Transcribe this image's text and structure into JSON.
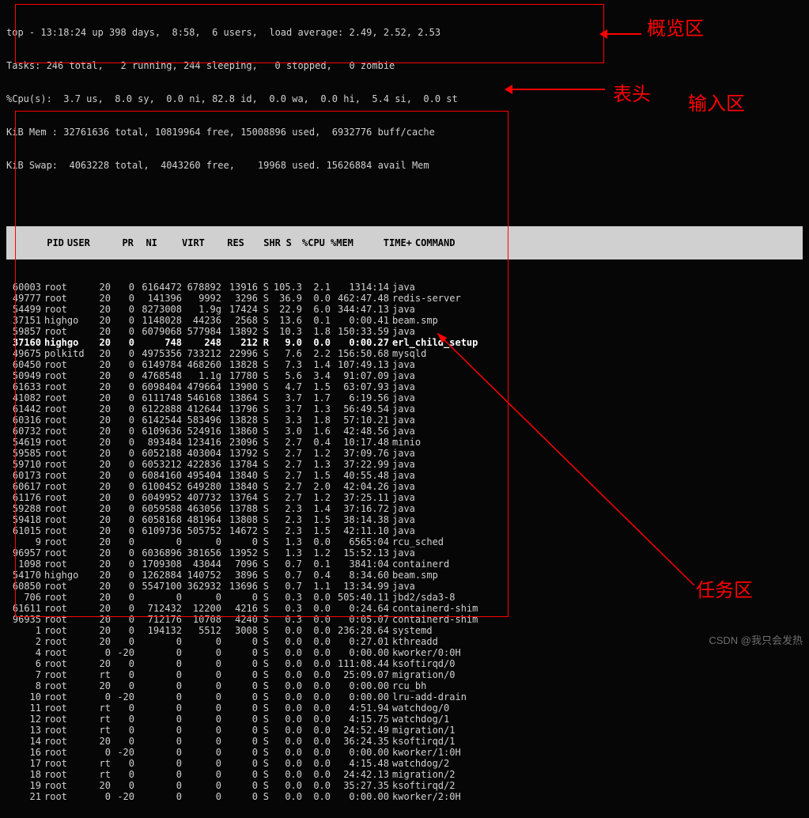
{
  "summary": {
    "line1_pre": "top - ",
    "time": "13:18:24",
    "line1_mid": " up 398 days,  8:58,  6 users,  load average: 2.49, 2.52, 2.53",
    "tasks": "Tasks: 246 total,   2 running, 244 sleeping,   0 stopped,   0 zombie",
    "cpu": "%Cpu(s):  3.7 us,  8.0 sy,  0.0 ni, 82.8 id,  0.0 wa,  0.0 hi,  5.4 si,  0.0 st",
    "mem": "KiB Mem : 32761636 total, 10819964 free, 15008896 used,  6932776 buff/cache",
    "swap": "KiB Swap:  4063228 total,  4043260 free,    19968 used. 15626884 avail Mem"
  },
  "header": {
    "pid": "PID",
    "user": "USER",
    "pr": "PR",
    "ni": "NI",
    "virt": "VIRT",
    "res": "RES",
    "shr": "SHR",
    "s": "S",
    "cpu": "%CPU",
    "mem": "%MEM",
    "time": "TIME+",
    "cmd": "COMMAND"
  },
  "processes": [
    {
      "pid": "60003",
      "user": "root",
      "pr": "20",
      "ni": "0",
      "virt": "6164472",
      "res": "678892",
      "shr": "13916",
      "s": "S",
      "cpu": "105.3",
      "mem": "2.1",
      "time": "1314:14",
      "cmd": "java",
      "bold": false
    },
    {
      "pid": "49777",
      "user": "root",
      "pr": "20",
      "ni": "0",
      "virt": "141396",
      "res": "9992",
      "shr": "3296",
      "s": "S",
      "cpu": "36.9",
      "mem": "0.0",
      "time": "462:47.48",
      "cmd": "redis-server",
      "bold": false
    },
    {
      "pid": "54499",
      "user": "root",
      "pr": "20",
      "ni": "0",
      "virt": "8273008",
      "res": "1.9g",
      "shr": "17424",
      "s": "S",
      "cpu": "22.9",
      "mem": "6.0",
      "time": "344:47.13",
      "cmd": "java",
      "bold": false
    },
    {
      "pid": "37151",
      "user": "highgo",
      "pr": "20",
      "ni": "0",
      "virt": "1148028",
      "res": "44236",
      "shr": "2568",
      "s": "S",
      "cpu": "13.6",
      "mem": "0.1",
      "time": "0:00.41",
      "cmd": "beam.smp",
      "bold": false
    },
    {
      "pid": "59857",
      "user": "root",
      "pr": "20",
      "ni": "0",
      "virt": "6079068",
      "res": "577984",
      "shr": "13892",
      "s": "S",
      "cpu": "10.3",
      "mem": "1.8",
      "time": "150:33.59",
      "cmd": "java",
      "bold": false
    },
    {
      "pid": "37160",
      "user": "highgo",
      "pr": "20",
      "ni": "0",
      "virt": "748",
      "res": "248",
      "shr": "212",
      "s": "R",
      "cpu": "9.0",
      "mem": "0.0",
      "time": "0:00.27",
      "cmd": "erl_child_setup",
      "bold": true
    },
    {
      "pid": "49675",
      "user": "polkitd",
      "pr": "20",
      "ni": "0",
      "virt": "4975356",
      "res": "733212",
      "shr": "22996",
      "s": "S",
      "cpu": "7.6",
      "mem": "2.2",
      "time": "156:50.68",
      "cmd": "mysqld",
      "bold": false
    },
    {
      "pid": "60450",
      "user": "root",
      "pr": "20",
      "ni": "0",
      "virt": "6149784",
      "res": "468260",
      "shr": "13828",
      "s": "S",
      "cpu": "7.3",
      "mem": "1.4",
      "time": "107:49.13",
      "cmd": "java",
      "bold": false
    },
    {
      "pid": "50949",
      "user": "root",
      "pr": "20",
      "ni": "0",
      "virt": "4768548",
      "res": "1.1g",
      "shr": "17780",
      "s": "S",
      "cpu": "5.6",
      "mem": "3.4",
      "time": "91:07.09",
      "cmd": "java",
      "bold": false
    },
    {
      "pid": "61633",
      "user": "root",
      "pr": "20",
      "ni": "0",
      "virt": "6098404",
      "res": "479664",
      "shr": "13900",
      "s": "S",
      "cpu": "4.7",
      "mem": "1.5",
      "time": "63:07.93",
      "cmd": "java",
      "bold": false
    },
    {
      "pid": "41082",
      "user": "root",
      "pr": "20",
      "ni": "0",
      "virt": "6111748",
      "res": "546168",
      "shr": "13864",
      "s": "S",
      "cpu": "3.7",
      "mem": "1.7",
      "time": "6:19.56",
      "cmd": "java",
      "bold": false
    },
    {
      "pid": "61442",
      "user": "root",
      "pr": "20",
      "ni": "0",
      "virt": "6122888",
      "res": "412644",
      "shr": "13796",
      "s": "S",
      "cpu": "3.7",
      "mem": "1.3",
      "time": "56:49.54",
      "cmd": "java",
      "bold": false
    },
    {
      "pid": "60316",
      "user": "root",
      "pr": "20",
      "ni": "0",
      "virt": "6142544",
      "res": "583496",
      "shr": "13828",
      "s": "S",
      "cpu": "3.3",
      "mem": "1.8",
      "time": "57:10.21",
      "cmd": "java",
      "bold": false
    },
    {
      "pid": "60732",
      "user": "root",
      "pr": "20",
      "ni": "0",
      "virt": "6109636",
      "res": "524916",
      "shr": "13860",
      "s": "S",
      "cpu": "3.0",
      "mem": "1.6",
      "time": "42:48.56",
      "cmd": "java",
      "bold": false
    },
    {
      "pid": "54619",
      "user": "root",
      "pr": "20",
      "ni": "0",
      "virt": "893484",
      "res": "123416",
      "shr": "23096",
      "s": "S",
      "cpu": "2.7",
      "mem": "0.4",
      "time": "10:17.48",
      "cmd": "minio",
      "bold": false
    },
    {
      "pid": "59585",
      "user": "root",
      "pr": "20",
      "ni": "0",
      "virt": "6052188",
      "res": "403004",
      "shr": "13792",
      "s": "S",
      "cpu": "2.7",
      "mem": "1.2",
      "time": "37:09.76",
      "cmd": "java",
      "bold": false
    },
    {
      "pid": "59710",
      "user": "root",
      "pr": "20",
      "ni": "0",
      "virt": "6053212",
      "res": "422836",
      "shr": "13784",
      "s": "S",
      "cpu": "2.7",
      "mem": "1.3",
      "time": "37:22.99",
      "cmd": "java",
      "bold": false
    },
    {
      "pid": "60173",
      "user": "root",
      "pr": "20",
      "ni": "0",
      "virt": "6084160",
      "res": "495404",
      "shr": "13840",
      "s": "S",
      "cpu": "2.7",
      "mem": "1.5",
      "time": "40:55.48",
      "cmd": "java",
      "bold": false
    },
    {
      "pid": "60617",
      "user": "root",
      "pr": "20",
      "ni": "0",
      "virt": "6100452",
      "res": "649280",
      "shr": "13840",
      "s": "S",
      "cpu": "2.7",
      "mem": "2.0",
      "time": "42:04.26",
      "cmd": "java",
      "bold": false
    },
    {
      "pid": "61176",
      "user": "root",
      "pr": "20",
      "ni": "0",
      "virt": "6049952",
      "res": "407732",
      "shr": "13764",
      "s": "S",
      "cpu": "2.7",
      "mem": "1.2",
      "time": "37:25.11",
      "cmd": "java",
      "bold": false
    },
    {
      "pid": "59288",
      "user": "root",
      "pr": "20",
      "ni": "0",
      "virt": "6059588",
      "res": "463056",
      "shr": "13788",
      "s": "S",
      "cpu": "2.3",
      "mem": "1.4",
      "time": "37:16.72",
      "cmd": "java",
      "bold": false
    },
    {
      "pid": "59418",
      "user": "root",
      "pr": "20",
      "ni": "0",
      "virt": "6058168",
      "res": "481964",
      "shr": "13808",
      "s": "S",
      "cpu": "2.3",
      "mem": "1.5",
      "time": "38:14.38",
      "cmd": "java",
      "bold": false
    },
    {
      "pid": "61015",
      "user": "root",
      "pr": "20",
      "ni": "0",
      "virt": "6109736",
      "res": "505752",
      "shr": "14672",
      "s": "S",
      "cpu": "2.3",
      "mem": "1.5",
      "time": "42:11.10",
      "cmd": "java",
      "bold": false
    },
    {
      "pid": "9",
      "user": "root",
      "pr": "20",
      "ni": "0",
      "virt": "0",
      "res": "0",
      "shr": "0",
      "s": "S",
      "cpu": "1.3",
      "mem": "0.0",
      "time": "6565:04",
      "cmd": "rcu_sched",
      "bold": false
    },
    {
      "pid": "96957",
      "user": "root",
      "pr": "20",
      "ni": "0",
      "virt": "6036896",
      "res": "381656",
      "shr": "13952",
      "s": "S",
      "cpu": "1.3",
      "mem": "1.2",
      "time": "15:52.13",
      "cmd": "java",
      "bold": false
    },
    {
      "pid": "1098",
      "user": "root",
      "pr": "20",
      "ni": "0",
      "virt": "1709308",
      "res": "43044",
      "shr": "7096",
      "s": "S",
      "cpu": "0.7",
      "mem": "0.1",
      "time": "3841:04",
      "cmd": "containerd",
      "bold": false
    },
    {
      "pid": "54170",
      "user": "highgo",
      "pr": "20",
      "ni": "0",
      "virt": "1262884",
      "res": "140752",
      "shr": "3896",
      "s": "S",
      "cpu": "0.7",
      "mem": "0.4",
      "time": "8:34.60",
      "cmd": "beam.smp",
      "bold": false
    },
    {
      "pid": "60850",
      "user": "root",
      "pr": "20",
      "ni": "0",
      "virt": "5547100",
      "res": "362932",
      "shr": "13696",
      "s": "S",
      "cpu": "0.7",
      "mem": "1.1",
      "time": "13:34.99",
      "cmd": "java",
      "bold": false
    },
    {
      "pid": "706",
      "user": "root",
      "pr": "20",
      "ni": "0",
      "virt": "0",
      "res": "0",
      "shr": "0",
      "s": "S",
      "cpu": "0.3",
      "mem": "0.0",
      "time": "505:40.11",
      "cmd": "jbd2/sda3-8",
      "bold": false
    },
    {
      "pid": "61611",
      "user": "root",
      "pr": "20",
      "ni": "0",
      "virt": "712432",
      "res": "12200",
      "shr": "4216",
      "s": "S",
      "cpu": "0.3",
      "mem": "0.0",
      "time": "0:24.64",
      "cmd": "containerd-shim",
      "bold": false
    },
    {
      "pid": "96935",
      "user": "root",
      "pr": "20",
      "ni": "0",
      "virt": "712176",
      "res": "10708",
      "shr": "4240",
      "s": "S",
      "cpu": "0.3",
      "mem": "0.0",
      "time": "0:05.07",
      "cmd": "containerd-shim",
      "bold": false
    },
    {
      "pid": "1",
      "user": "root",
      "pr": "20",
      "ni": "0",
      "virt": "194132",
      "res": "5512",
      "shr": "3008",
      "s": "S",
      "cpu": "0.0",
      "mem": "0.0",
      "time": "236:28.64",
      "cmd": "systemd",
      "bold": false
    },
    {
      "pid": "2",
      "user": "root",
      "pr": "20",
      "ni": "0",
      "virt": "0",
      "res": "0",
      "shr": "0",
      "s": "S",
      "cpu": "0.0",
      "mem": "0.0",
      "time": "0:27.01",
      "cmd": "kthreadd",
      "bold": false
    },
    {
      "pid": "4",
      "user": "root",
      "pr": "0",
      "ni": "-20",
      "virt": "0",
      "res": "0",
      "shr": "0",
      "s": "S",
      "cpu": "0.0",
      "mem": "0.0",
      "time": "0:00.00",
      "cmd": "kworker/0:0H",
      "bold": false
    },
    {
      "pid": "6",
      "user": "root",
      "pr": "20",
      "ni": "0",
      "virt": "0",
      "res": "0",
      "shr": "0",
      "s": "S",
      "cpu": "0.0",
      "mem": "0.0",
      "time": "111:08.44",
      "cmd": "ksoftirqd/0",
      "bold": false
    },
    {
      "pid": "7",
      "user": "root",
      "pr": "rt",
      "ni": "0",
      "virt": "0",
      "res": "0",
      "shr": "0",
      "s": "S",
      "cpu": "0.0",
      "mem": "0.0",
      "time": "25:09.07",
      "cmd": "migration/0",
      "bold": false
    },
    {
      "pid": "8",
      "user": "root",
      "pr": "20",
      "ni": "0",
      "virt": "0",
      "res": "0",
      "shr": "0",
      "s": "S",
      "cpu": "0.0",
      "mem": "0.0",
      "time": "0:00.00",
      "cmd": "rcu_bh",
      "bold": false
    },
    {
      "pid": "10",
      "user": "root",
      "pr": "0",
      "ni": "-20",
      "virt": "0",
      "res": "0",
      "shr": "0",
      "s": "S",
      "cpu": "0.0",
      "mem": "0.0",
      "time": "0:00.00",
      "cmd": "lru-add-drain",
      "bold": false
    },
    {
      "pid": "11",
      "user": "root",
      "pr": "rt",
      "ni": "0",
      "virt": "0",
      "res": "0",
      "shr": "0",
      "s": "S",
      "cpu": "0.0",
      "mem": "0.0",
      "time": "4:51.94",
      "cmd": "watchdog/0",
      "bold": false
    },
    {
      "pid": "12",
      "user": "root",
      "pr": "rt",
      "ni": "0",
      "virt": "0",
      "res": "0",
      "shr": "0",
      "s": "S",
      "cpu": "0.0",
      "mem": "0.0",
      "time": "4:15.75",
      "cmd": "watchdog/1",
      "bold": false
    },
    {
      "pid": "13",
      "user": "root",
      "pr": "rt",
      "ni": "0",
      "virt": "0",
      "res": "0",
      "shr": "0",
      "s": "S",
      "cpu": "0.0",
      "mem": "0.0",
      "time": "24:52.49",
      "cmd": "migration/1",
      "bold": false
    },
    {
      "pid": "14",
      "user": "root",
      "pr": "20",
      "ni": "0",
      "virt": "0",
      "res": "0",
      "shr": "0",
      "s": "S",
      "cpu": "0.0",
      "mem": "0.0",
      "time": "36:24.35",
      "cmd": "ksoftirqd/1",
      "bold": false
    },
    {
      "pid": "16",
      "user": "root",
      "pr": "0",
      "ni": "-20",
      "virt": "0",
      "res": "0",
      "shr": "0",
      "s": "S",
      "cpu": "0.0",
      "mem": "0.0",
      "time": "0:00.00",
      "cmd": "kworker/1:0H",
      "bold": false
    },
    {
      "pid": "17",
      "user": "root",
      "pr": "rt",
      "ni": "0",
      "virt": "0",
      "res": "0",
      "shr": "0",
      "s": "S",
      "cpu": "0.0",
      "mem": "0.0",
      "time": "4:15.48",
      "cmd": "watchdog/2",
      "bold": false
    },
    {
      "pid": "18",
      "user": "root",
      "pr": "rt",
      "ni": "0",
      "virt": "0",
      "res": "0",
      "shr": "0",
      "s": "S",
      "cpu": "0.0",
      "mem": "0.0",
      "time": "24:42.13",
      "cmd": "migration/2",
      "bold": false
    },
    {
      "pid": "19",
      "user": "root",
      "pr": "20",
      "ni": "0",
      "virt": "0",
      "res": "0",
      "shr": "0",
      "s": "S",
      "cpu": "0.0",
      "mem": "0.0",
      "time": "35:27.35",
      "cmd": "ksoftirqd/2",
      "bold": false
    },
    {
      "pid": "21",
      "user": "root",
      "pr": "0",
      "ni": "-20",
      "virt": "0",
      "res": "0",
      "shr": "0",
      "s": "S",
      "cpu": "0.0",
      "mem": "0.0",
      "time": "0:00.00",
      "cmd": "kworker/2:0H",
      "bold": false
    }
  ],
  "annotations": {
    "overview": "概览区",
    "header_label": "表头",
    "input_label": "输入区",
    "tasks_label": "任务区"
  },
  "watermark": "CSDN @我只会发热"
}
